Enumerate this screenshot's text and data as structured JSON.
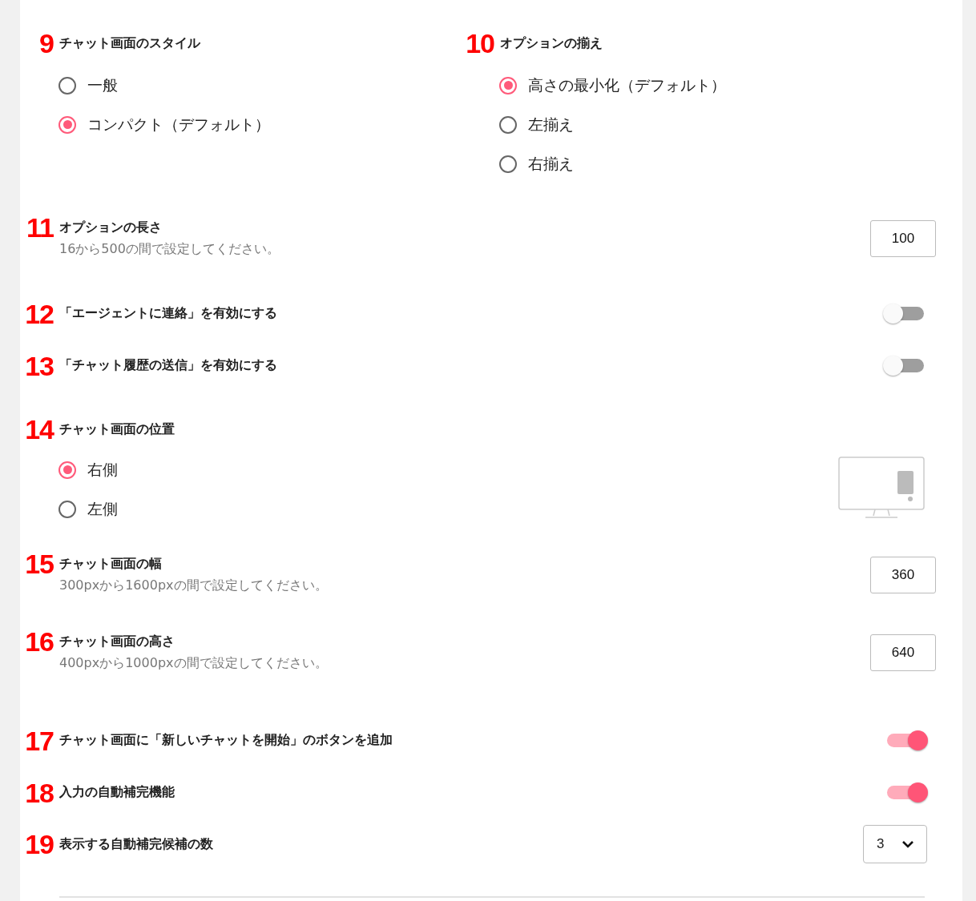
{
  "top_row": [
    {
      "marker": "9",
      "title": "チャット画面のスタイル",
      "options": [
        {
          "label": "一般",
          "selected": false
        },
        {
          "label": "コンパクト（デフォルト）",
          "selected": true
        }
      ]
    },
    {
      "marker": "10",
      "title": "オプションの揃え",
      "options": [
        {
          "label": "高さの最小化（デフォルト）",
          "selected": true
        },
        {
          "label": "左揃え",
          "selected": false
        },
        {
          "label": "右揃え",
          "selected": false
        }
      ]
    }
  ],
  "settings": [
    {
      "kind": "number",
      "marker": "11",
      "title": "オプションの長さ",
      "description": "16から500の間で設定してください。",
      "value": "100"
    },
    {
      "kind": "toggle",
      "marker": "12",
      "title": "「エージェントに連絡」を有効にする",
      "on": false
    },
    {
      "kind": "toggle",
      "marker": "13",
      "title": "「チャット履歴の送信」を有効にする",
      "on": false
    },
    {
      "kind": "position",
      "marker": "14",
      "title": "チャット画面の位置",
      "options": [
        {
          "label": "右側",
          "selected": true
        },
        {
          "label": "左側",
          "selected": false
        }
      ]
    },
    {
      "kind": "number",
      "marker": "15",
      "title": "チャット画面の幅",
      "description": "300pxから1600pxの間で設定してください。",
      "value": "360"
    },
    {
      "kind": "number",
      "marker": "16",
      "title": "チャット画面の高さ",
      "description": "400pxから1000pxの間で設定してください。",
      "value": "640"
    },
    {
      "kind": "toggle",
      "marker": "17",
      "title": "チャット画面に「新しいチャットを開始」のボタンを追加",
      "on": true
    },
    {
      "kind": "toggle",
      "marker": "18",
      "title": "入力の自動補完機能",
      "on": true
    },
    {
      "kind": "select",
      "marker": "19",
      "title": "表示する自動補完候補の数",
      "value": "3"
    }
  ]
}
